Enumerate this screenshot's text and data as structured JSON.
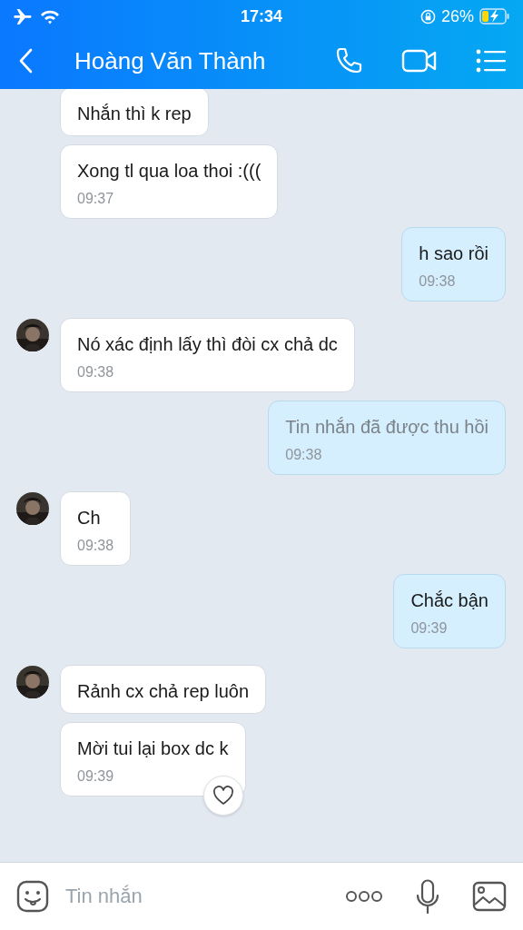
{
  "status_bar": {
    "time": "17:34",
    "battery": "26%"
  },
  "header": {
    "title": "Hoàng Văn Thành"
  },
  "messages": [
    {
      "kind": "incoming",
      "text": "Nhắn thì k rep",
      "avatar": false,
      "recalled": false,
      "reaction": false
    },
    {
      "kind": "incoming",
      "text": "Xong tl qua loa thoi :(((",
      "time": "09:37",
      "avatar": false,
      "recalled": false,
      "reaction": false
    },
    {
      "kind": "outgoing",
      "text": "h sao rồi",
      "time": "09:38",
      "avatar": false,
      "recalled": false,
      "reaction": false
    },
    {
      "kind": "incoming",
      "text": "Nó xác định lấy thì đòi cx chả dc",
      "time": "09:38",
      "avatar": true,
      "recalled": false,
      "reaction": false
    },
    {
      "kind": "outgoing",
      "text": "Tin nhắn đã được thu hồi",
      "time": "09:38",
      "avatar": false,
      "recalled": true,
      "reaction": false
    },
    {
      "kind": "incoming",
      "text": "Ch",
      "time": "09:38",
      "avatar": true,
      "recalled": false,
      "reaction": false
    },
    {
      "kind": "outgoing",
      "text": "Chắc bận",
      "time": "09:39",
      "avatar": false,
      "recalled": false,
      "reaction": false
    },
    {
      "kind": "incoming",
      "text": "Rảnh cx chả rep luôn",
      "avatar": true,
      "recalled": false,
      "reaction": false
    },
    {
      "kind": "incoming",
      "text": "Mời tui lại box dc k",
      "time": "09:39",
      "avatar": false,
      "recalled": false,
      "reaction": true
    }
  ],
  "composer": {
    "placeholder": "Tin nhắn"
  }
}
